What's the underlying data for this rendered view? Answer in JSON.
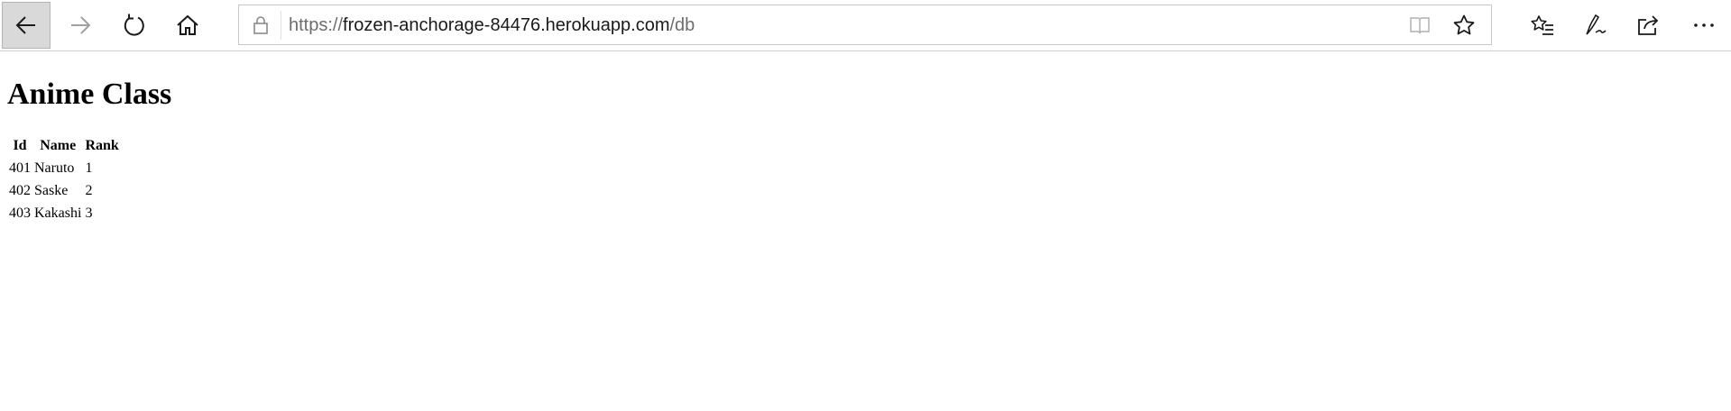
{
  "browser": {
    "address_bar": {
      "scheme": "https://",
      "host": "frozen-anchorage-84476.herokuapp.com",
      "path": "/db"
    },
    "icons": [
      "back-icon",
      "forward-icon",
      "refresh-icon",
      "home-icon",
      "lock-icon",
      "reading-view-icon",
      "favorite-star-icon",
      "favorites-list-icon",
      "pen-icon",
      "share-icon",
      "more-icon"
    ]
  },
  "page": {
    "heading": "Anime Class",
    "table": {
      "headers": [
        "Id",
        "Name",
        "Rank"
      ],
      "rows": [
        [
          "401",
          "Naruto",
          "1"
        ],
        [
          "402",
          "Saske",
          "2"
        ],
        [
          "403",
          "Kakashi",
          "3"
        ]
      ]
    }
  }
}
